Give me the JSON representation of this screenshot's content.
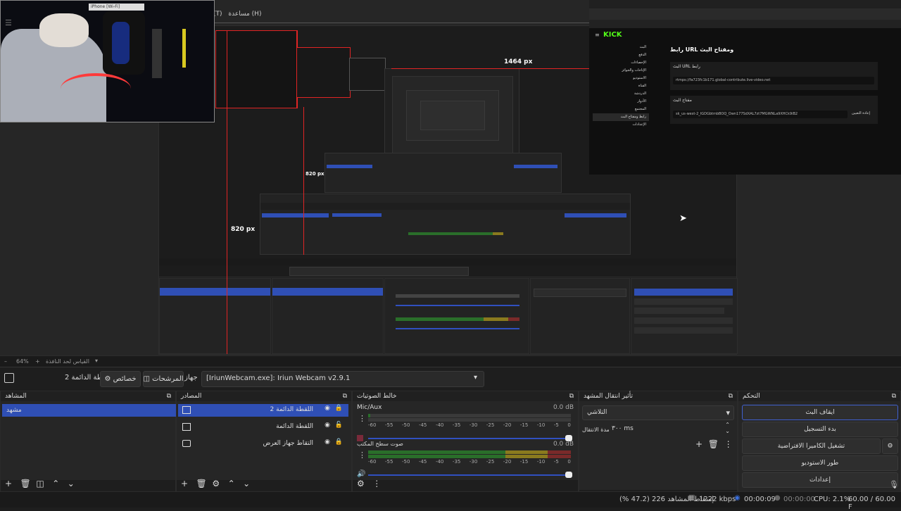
{
  "menu": {
    "tools": "(T)",
    "help": "مساعدة (H)"
  },
  "measure": {
    "w": "1464 px",
    "h1": "820 px",
    "h2": "820 px"
  },
  "webcam": {
    "titlebar": "iPhone [Wi-Fi]"
  },
  "kick": {
    "logo": "KICK",
    "heading": "رابط URL ومفتاح البث",
    "url_label": "البث URL رابط",
    "url_value": "rtmps://fa723fc1b171.global-contribute.live-video.net",
    "key_label": "مفتاح البث",
    "key_value": "sk_us-west-2_IGDGbtmbBOQ_Own177SdXAL7zt7MGWNLa9XHCk9iB2",
    "key_button": "إعادة التعيين",
    "nav": [
      "البث",
      "الدفع",
      "الإحصاءات",
      "الإتاحات والجوائز",
      "الاستوديو",
      "القناة",
      "الدردشة",
      "الأدوار",
      "المجتمع",
      "رابط ومفتاح البث",
      "الإعدادات"
    ]
  },
  "zoom": {
    "level": "64%",
    "label": "القياس لحد النافذة"
  },
  "toolbar": {
    "scene_name": "اللقطة الدائمة 2",
    "properties": "خصائص",
    "filters": "المرشحات",
    "device_label": "جهاز",
    "device_value": "[IriunWebcam.exe]: Iriun Webcam v2.9.1"
  },
  "scenes": {
    "title": "المشاهد",
    "items": [
      "مشهد"
    ]
  },
  "sources": {
    "title": "المصادر",
    "items": [
      "اللقطة الدائمة 2",
      "اللقطة الدائمة",
      "التقاط جهاز العرض"
    ]
  },
  "mixer": {
    "title": "خالط الصوتيات",
    "ch1": {
      "name": "Mic/Aux",
      "db": "0.0 dB"
    },
    "ch2": {
      "name": "صوت سطح المكتب",
      "db": "0.0 dB"
    },
    "ticks": [
      "-60",
      "-55",
      "-50",
      "-45",
      "-40",
      "-35",
      "-30",
      "-25",
      "-20",
      "-15",
      "-10",
      "-5",
      "0"
    ]
  },
  "transitions": {
    "title": "تأثير انتقال المشهد",
    "type": "التلاشي",
    "duration_label": "مدة الانتقال",
    "duration_value": "٣٠٠ ms"
  },
  "controls": {
    "title": "التحكم",
    "stop_stream": "ايقاف البث",
    "start_record": "بدء التسجيل",
    "virtual_cam": "تشغيل الكاميرا الافتراضية",
    "studio_mode": "طور الاستوديو",
    "settings": "إعدادات"
  },
  "status": {
    "dropped": "إسقاط المشاهد 226 (47.2 %)",
    "bitrate": "1222 kbps",
    "live_time": "00:00:09",
    "rec_time": "00:00:00",
    "cpu": "CPU: 2.1%",
    "fps": "60.00 / 60.00 F"
  },
  "colors": {
    "accent": "#2f4fb5",
    "red_guide": "#e02424",
    "kick_green": "#53fc18"
  }
}
